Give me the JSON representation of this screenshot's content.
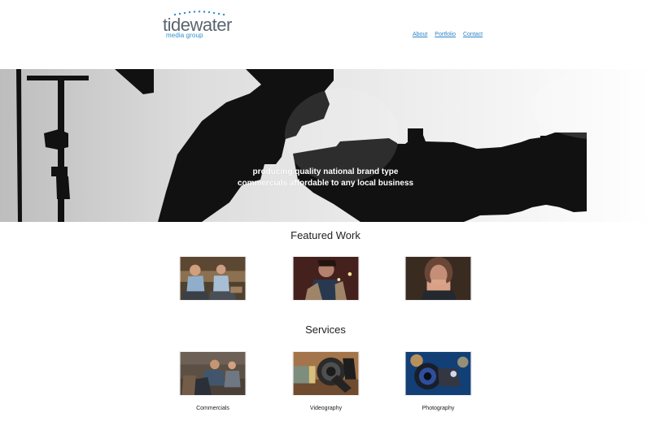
{
  "brand": {
    "name": "tidewater",
    "subtitle": "media group",
    "colors": {
      "primary_gray": "#5b6570",
      "accent_blue": "#2f90c9",
      "nav_blue": "#2b83c6"
    }
  },
  "nav": {
    "items": [
      {
        "label": "About"
      },
      {
        "label": "Portfolio"
      },
      {
        "label": "Contact"
      }
    ]
  },
  "hero": {
    "tagline_line1": "producing quality national brand type",
    "tagline_line2": "commercials affordable to any local business"
  },
  "featured": {
    "title": "Featured Work",
    "items": [
      {
        "icon": "image"
      },
      {
        "icon": "image"
      },
      {
        "icon": "image"
      }
    ]
  },
  "services": {
    "title": "Services",
    "items": [
      {
        "label": "Commercials",
        "icon": "image"
      },
      {
        "label": "Videography",
        "icon": "image"
      },
      {
        "label": "Photography",
        "icon": "image"
      }
    ]
  }
}
